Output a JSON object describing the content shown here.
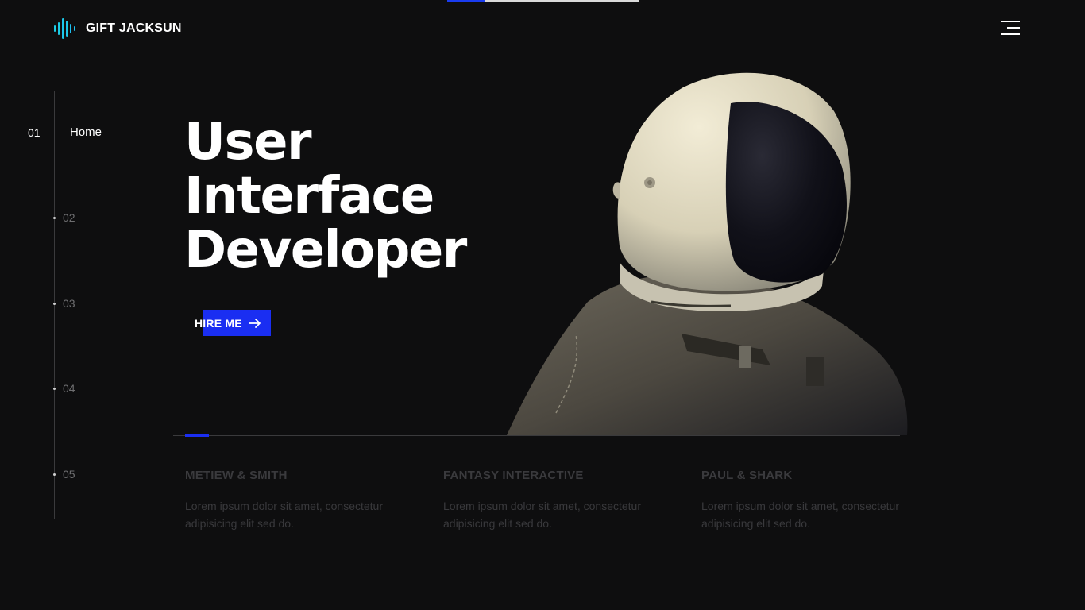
{
  "brand": {
    "name": "GIFT JACKSUN",
    "logo_icon": "sound-wave-icon",
    "accent": "#1a2ef2"
  },
  "header": {
    "menu_icon": "hamburger-menu-icon",
    "slide_progress": 0.2
  },
  "side_nav": {
    "items": [
      {
        "number": "01",
        "label": "Home",
        "active": true
      },
      {
        "number": "02",
        "label": "",
        "active": false
      },
      {
        "number": "03",
        "label": "",
        "active": false
      },
      {
        "number": "04",
        "label": "",
        "active": false
      },
      {
        "number": "05",
        "label": "",
        "active": false
      }
    ]
  },
  "hero": {
    "title_lines": [
      "User",
      "Interface",
      "Developer"
    ],
    "cta_label": "HIRE ME",
    "cta_icon": "arrow-right-icon",
    "image": "astronaut-helmet-image"
  },
  "clients": [
    {
      "name": "METIEW & SMITH",
      "description": "Lorem ipsum dolor sit amet, consectetur adipisicing elit sed do."
    },
    {
      "name": "FANTASY INTERACTIVE",
      "description": "Lorem ipsum dolor sit amet, consectetur adipisicing elit sed do."
    },
    {
      "name": "PAUL & SHARK",
      "description": "Lorem ipsum dolor sit amet, consectetur adipisicing elit sed do."
    }
  ]
}
